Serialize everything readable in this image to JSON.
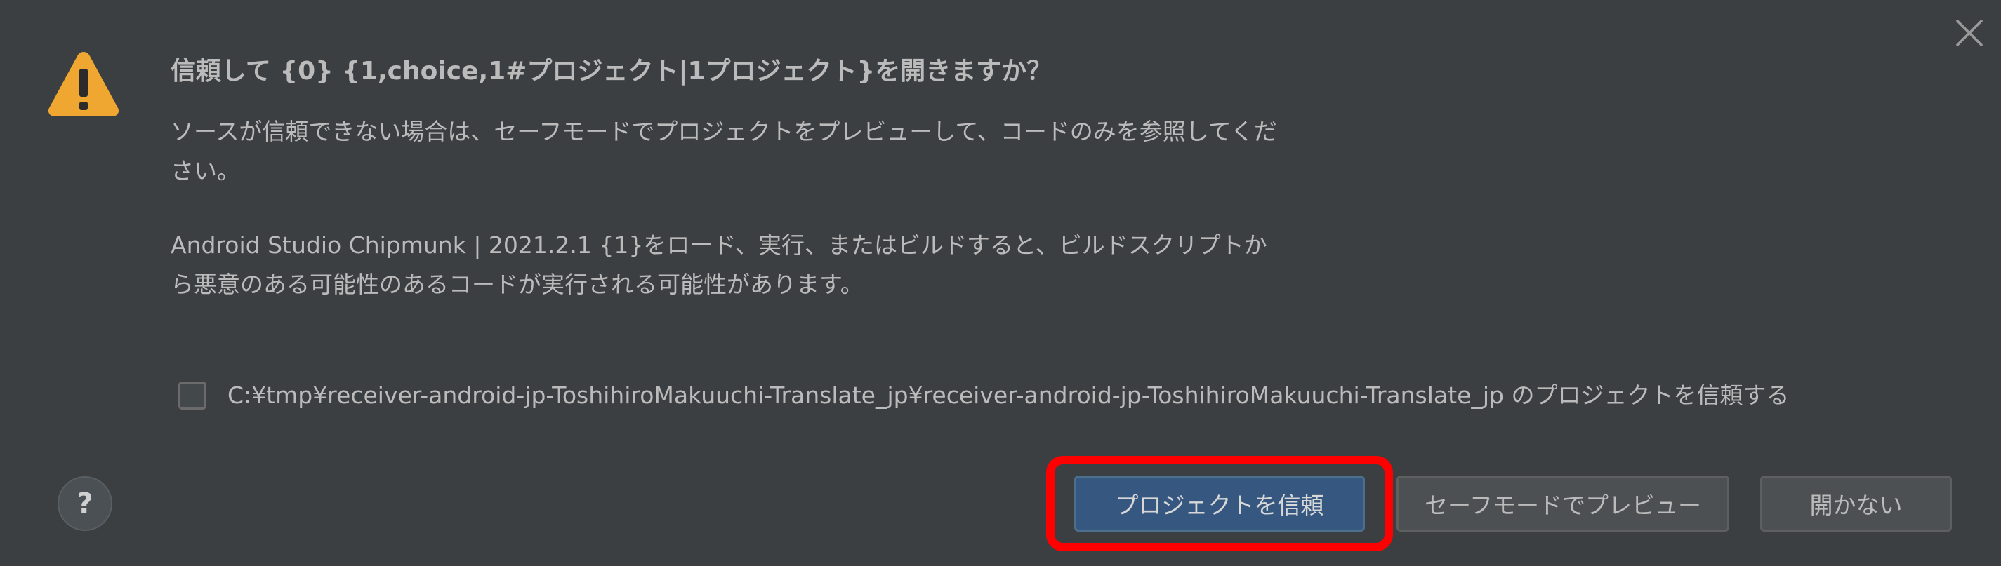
{
  "dialog": {
    "title": "信頼して {0} {1,choice,1#プロジェクト|1プロジェクト}を開きますか？",
    "paragraph1": "ソースが信頼できない場合は、セーフモードでプロジェクトをプレビューして、コードのみを参照してください。",
    "paragraph2": "Android Studio Chipmunk | 2021.2.1 {1}をロード、実行、またはビルドすると、ビルドスクリプトから悪意のある可能性のあるコードが実行される可能性があります。",
    "trust_checkbox": {
      "label": "C:¥tmp¥receiver-android-jp-ToshihiroMakuuchi-Translate_jp¥receiver-android-jp-ToshihiroMakuuchi-Translate_jp のプロジェクトを信頼する",
      "checked": false
    },
    "help_label": "?",
    "buttons": {
      "trust_project": "プロジェクトを信頼",
      "safe_mode_preview": "セーフモードでプレビュー",
      "dont_open": "開かない"
    },
    "icons": {
      "warning": "warning-icon",
      "close": "close-icon"
    }
  },
  "colors": {
    "background": "#3c3f41",
    "text": "#bbbbbb",
    "primary_button": "#365880",
    "warning_yellow": "#f0a732",
    "highlight": "#ff0000"
  }
}
